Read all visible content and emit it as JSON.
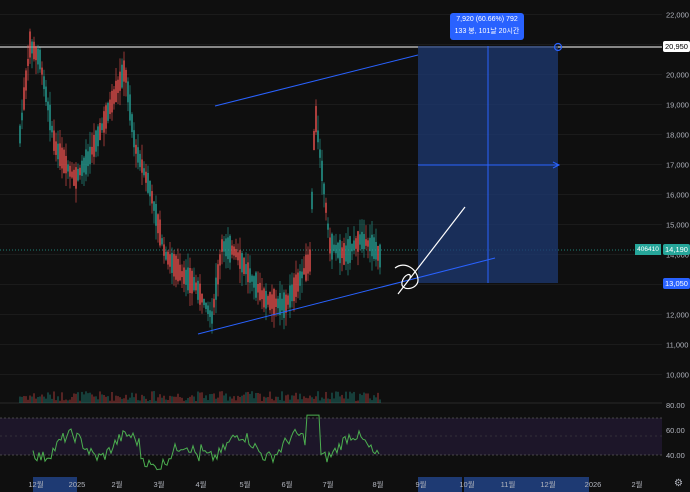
{
  "chart_data": {
    "type": "candlestick",
    "y_axis": {
      "ticks": [
        "22,000",
        "21,000",
        "20,000",
        "19,000",
        "18,000",
        "17,000",
        "16,000",
        "15,000",
        "14,000",
        "13,000",
        "12,000",
        "11,000",
        "10,000"
      ],
      "ylim": [
        9000,
        22500
      ]
    },
    "rsi_axis": {
      "ticks": [
        "80.00",
        "60.00",
        "40.00"
      ],
      "ylim": [
        25,
        85
      ]
    },
    "x_axis": {
      "ticks": [
        "12월",
        "2025",
        "2월",
        "3월",
        "4월",
        "5월",
        "6월",
        "7월",
        "8월",
        "9월",
        "10월",
        "11월",
        "12월",
        "2026",
        "2월"
      ],
      "highlighted": [
        "9월",
        "10월",
        "11월",
        "12월"
      ]
    },
    "price_labels": {
      "target": "20,950",
      "current": "14,190",
      "current_symbol": "406410",
      "stop": "13,050"
    },
    "measure_tool": {
      "line1": "7,920 (60.66%) 792",
      "line2": "133 봉, 101날 20시간",
      "from_price": 13050,
      "to_price": 20950
    },
    "colors": {
      "up": "#26a69a",
      "down": "#ef5350",
      "trendline": "#2962ff",
      "rsi": "#4caf50",
      "target_box": "#1e3a73",
      "background": "#0f0f0f"
    }
  },
  "ui": {
    "settings_icon": "gear-icon"
  }
}
